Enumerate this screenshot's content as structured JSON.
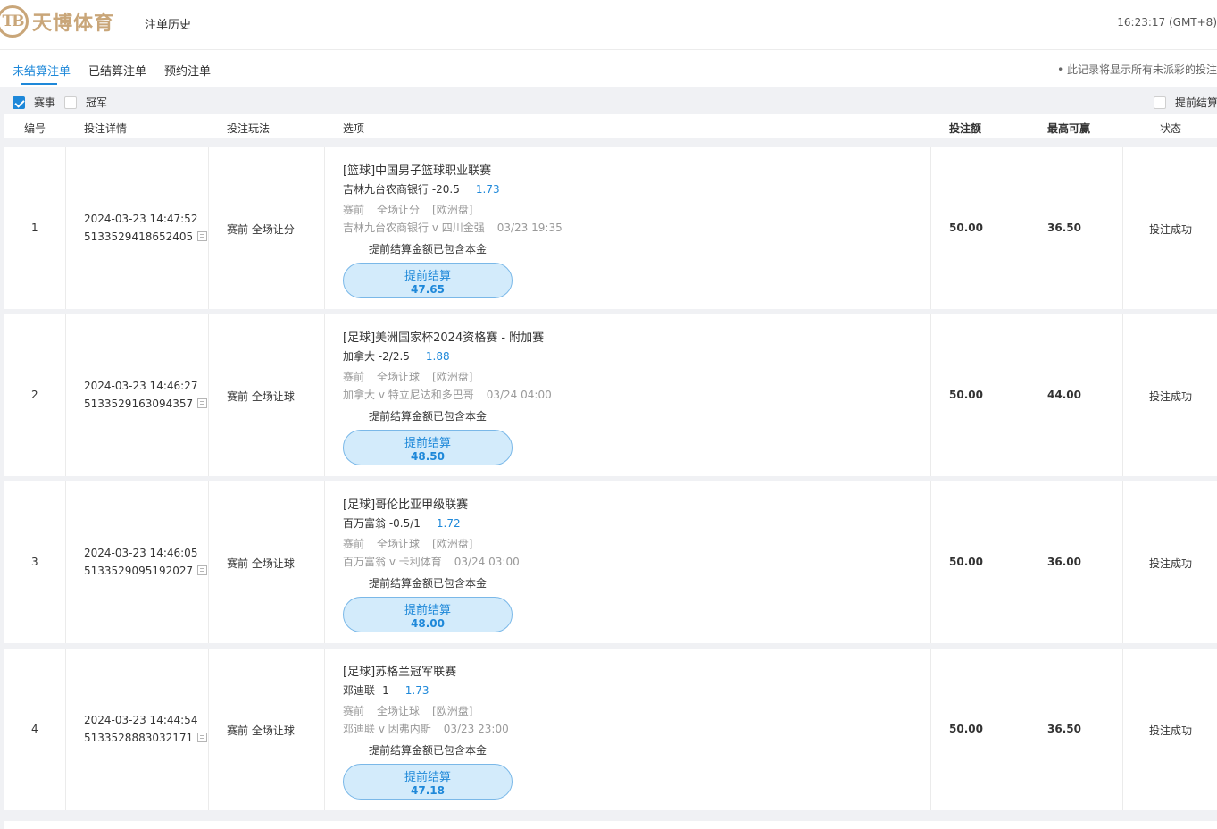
{
  "brand": {
    "logo_mark": "TB",
    "name": "天博体育"
  },
  "header": {
    "title": "注单历史",
    "clock": "16:23:17 (GMT+8)"
  },
  "tabs": [
    {
      "label": "未结算注单",
      "active": true
    },
    {
      "label": "已结算注单",
      "active": false
    },
    {
      "label": "预约注单",
      "active": false
    }
  ],
  "notice": "• 此记录将显示所有未派彩的投注",
  "filters": {
    "event": {
      "label": "赛事",
      "checked": true
    },
    "outright": {
      "label": "冠军",
      "checked": false
    },
    "cashout": {
      "label": "提前结算",
      "checked": false
    }
  },
  "columns": {
    "no": "编号",
    "detail": "投注详情",
    "type": "投注玩法",
    "option": "选项",
    "stake": "投注额",
    "max_win": "最高可赢",
    "status": "状态"
  },
  "bets": [
    {
      "no": "1",
      "time": "2024-03-23 14:47:52",
      "id": "5133529418652405",
      "type": "赛前 全场让分",
      "league": "[篮球]中国男子篮球职业联赛",
      "selection": "吉林九台农商银行 -20.5",
      "odds": "1.73",
      "market_1": "赛前",
      "market_2": "全场让分",
      "market_3": "[欧洲盘]",
      "match": "吉林九台农商银行 v 四川金强",
      "match_time": "03/23 19:35",
      "cashout_note": "提前结算金额已包含本金",
      "cashout_label": "提前结算",
      "cashout_amount": "47.65",
      "stake": "50.00",
      "max_win": "36.50",
      "status": "投注成功"
    },
    {
      "no": "2",
      "time": "2024-03-23 14:46:27",
      "id": "5133529163094357",
      "type": "赛前 全场让球",
      "league": "[足球]美洲国家杯2024资格赛 - 附加赛",
      "selection": "加拿大 -2/2.5",
      "odds": "1.88",
      "market_1": "赛前",
      "market_2": "全场让球",
      "market_3": "[欧洲盘]",
      "match": "加拿大 v 特立尼达和多巴哥",
      "match_time": "03/24 04:00",
      "cashout_note": "提前结算金额已包含本金",
      "cashout_label": "提前结算",
      "cashout_amount": "48.50",
      "stake": "50.00",
      "max_win": "44.00",
      "status": "投注成功"
    },
    {
      "no": "3",
      "time": "2024-03-23 14:46:05",
      "id": "5133529095192027",
      "type": "赛前 全场让球",
      "league": "[足球]哥伦比亚甲级联赛",
      "selection": "百万富翁 -0.5/1",
      "odds": "1.72",
      "market_1": "赛前",
      "market_2": "全场让球",
      "market_3": "[欧洲盘]",
      "match": "百万富翁 v 卡利体育",
      "match_time": "03/24 03:00",
      "cashout_note": "提前结算金额已包含本金",
      "cashout_label": "提前结算",
      "cashout_amount": "48.00",
      "stake": "50.00",
      "max_win": "36.00",
      "status": "投注成功"
    },
    {
      "no": "4",
      "time": "2024-03-23 14:44:54",
      "id": "5133528883032171",
      "type": "赛前 全场让球",
      "league": "[足球]苏格兰冠军联赛",
      "selection": "邓迪联 -1",
      "odds": "1.73",
      "market_1": "赛前",
      "market_2": "全场让球",
      "market_3": "[欧洲盘]",
      "match": "邓迪联 v 因弗内斯",
      "match_time": "03/23 23:00",
      "cashout_note": "提前结算金额已包含本金",
      "cashout_label": "提前结算",
      "cashout_amount": "47.18",
      "stake": "50.00",
      "max_win": "36.50",
      "status": "投注成功"
    }
  ],
  "colors": {
    "accent": "#1e88d9",
    "brand_gold": "#c9a679",
    "page_gray": "#f0f1f4",
    "cashout_fill": "#d3ebfb"
  },
  "icons": [
    "copy-icon",
    "checkbox-icon"
  ]
}
